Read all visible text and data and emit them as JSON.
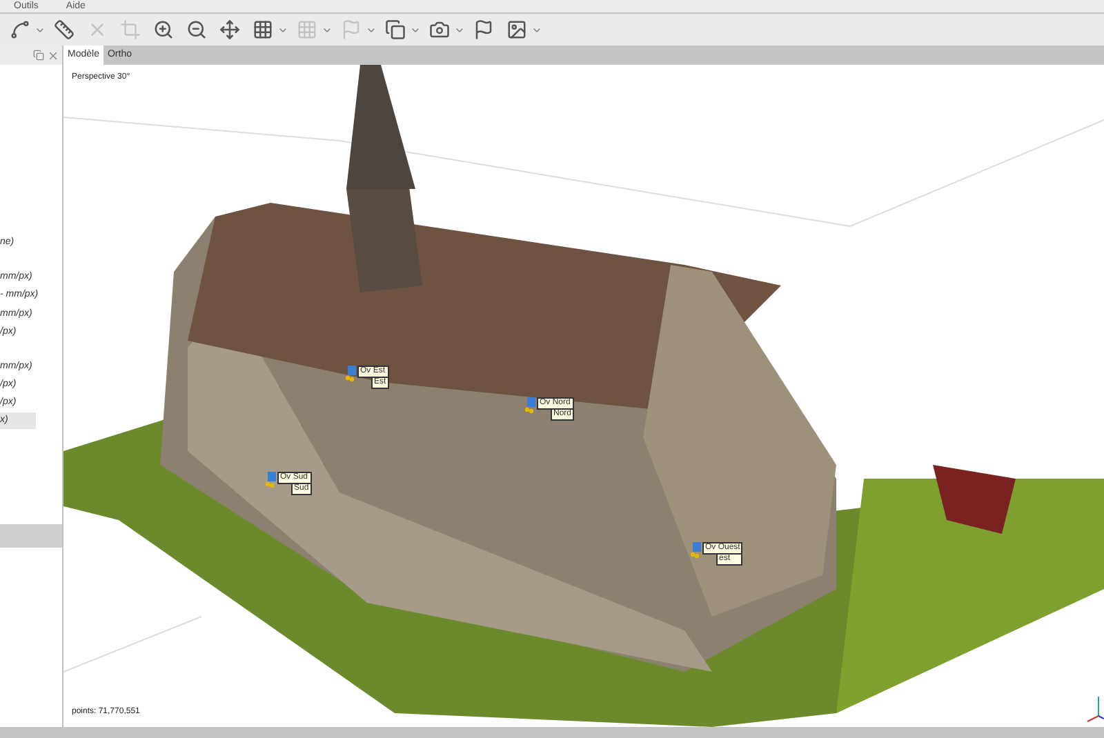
{
  "menu": [
    "Outils",
    "Aide"
  ],
  "tabs": [
    {
      "label": "Modèle",
      "selected": true
    },
    {
      "label": "Ortho",
      "selected": false
    }
  ],
  "sidebar": {
    "items": [
      {
        "label": "ne)",
        "selected": false
      },
      {
        "label": "mm/px)",
        "selected": false
      },
      {
        "label": "- mm/px)",
        "selected": false
      },
      {
        "label": "mm/px)",
        "selected": false
      },
      {
        "label": "/px)",
        "selected": false
      },
      {
        "label": "mm/px)",
        "selected": false
      },
      {
        "label": "/px)",
        "selected": false
      },
      {
        "label": "/px)",
        "selected": false
      },
      {
        "label": "x)",
        "selected": true
      }
    ]
  },
  "viewport": {
    "projection": "Perspective 30°",
    "status": "points: 71,770,551",
    "markers": [
      {
        "label": "Ov Est",
        "behind": "Est"
      },
      {
        "label": "Ov Nord",
        "behind": "Nord"
      },
      {
        "label": "Ov Sud",
        "behind": "Sud"
      },
      {
        "label": "Ov Ouest",
        "behind": "est"
      }
    ]
  }
}
